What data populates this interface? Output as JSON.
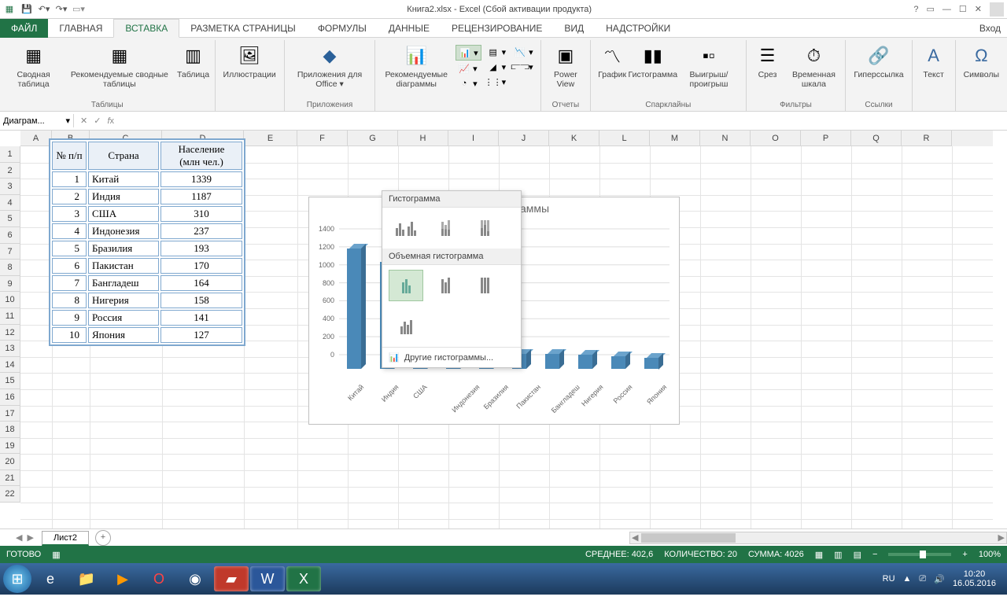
{
  "title": "Книга2.xlsx - Excel (Сбой активации продукта)",
  "signin": "Вход",
  "tabs": {
    "file": "ФАЙЛ",
    "home": "ГЛАВНАЯ",
    "insert": "ВСТАВКА",
    "layout": "РАЗМЕТКА СТРАНИЦЫ",
    "formulas": "ФОРМУЛЫ",
    "data": "ДАННЫЕ",
    "review": "РЕЦЕНЗИРОВАНИЕ",
    "view": "ВИД",
    "addins": "НАДСТРОЙКИ"
  },
  "ribbon": {
    "tables": {
      "pivot": "Сводная\nтаблица",
      "recpivot": "Рекомендуемые\nсводные таблицы",
      "table": "Таблица",
      "group": "Таблицы"
    },
    "illus": {
      "btn": "Иллюстрации"
    },
    "apps": {
      "btn": "Приложения\nдля Office ▾",
      "group": "Приложения"
    },
    "charts": {
      "rec": "Рекомендуемые\ndiаграммы",
      "group": "Диаграммы"
    },
    "reports": {
      "pv": "Power\nView",
      "group": "Отчеты"
    },
    "spark": {
      "line": "График",
      "col": "Гистограмма",
      "wl": "Выигрыш/\nпроигрыш",
      "group": "Спарклайны"
    },
    "filters": {
      "slicer": "Срез",
      "timeline": "Временная\nшкала",
      "group": "Фильтры"
    },
    "links": {
      "hyper": "Гиперссылка",
      "group": "Ссылки"
    },
    "text": {
      "btn": "Текст"
    },
    "symbols": {
      "btn": "Символы"
    }
  },
  "namebox": "Диаграм...",
  "columns": [
    "A",
    "B",
    "C",
    "D",
    "E",
    "F",
    "G",
    "H",
    "I",
    "J",
    "K",
    "L",
    "M",
    "N",
    "O",
    "P",
    "Q",
    "R"
  ],
  "rows": [
    "1",
    "2",
    "3",
    "4",
    "5",
    "6",
    "7",
    "8",
    "9",
    "10",
    "11",
    "12",
    "13",
    "14",
    "15",
    "16",
    "17",
    "18",
    "19",
    "20",
    "21",
    "22"
  ],
  "table": {
    "h1": "№ п/п",
    "h2": "Страна",
    "h3": "Население\n(млн чел.)",
    "rows": [
      {
        "n": "1",
        "c": "Китай",
        "p": "1339"
      },
      {
        "n": "2",
        "c": "Индия",
        "p": "1187"
      },
      {
        "n": "3",
        "c": "США",
        "p": "310"
      },
      {
        "n": "4",
        "c": "Индонезия",
        "p": "237"
      },
      {
        "n": "5",
        "c": "Бразилия",
        "p": "193"
      },
      {
        "n": "6",
        "c": "Пакистан",
        "p": "170"
      },
      {
        "n": "7",
        "c": "Бангладеш",
        "p": "164"
      },
      {
        "n": "8",
        "c": "Нигерия",
        "p": "158"
      },
      {
        "n": "9",
        "c": "Россия",
        "p": "141"
      },
      {
        "n": "10",
        "c": "Япония",
        "p": "127"
      }
    ]
  },
  "dropdown": {
    "s1": "Гистограмма",
    "s2": "Объемная гистограмма",
    "more": "Другие гистограммы..."
  },
  "chart_data": {
    "type": "bar",
    "title": "Название диаграммы",
    "categories": [
      "Китай",
      "Индия",
      "США",
      "Индонезия",
      "Бразилия",
      "Пакистан",
      "Бангладеш",
      "Нигерия",
      "Россия",
      "Япония"
    ],
    "values": [
      1339,
      1187,
      310,
      237,
      193,
      170,
      164,
      158,
      141,
      127
    ],
    "ylim": [
      0,
      1400
    ],
    "yticks": [
      0,
      200,
      400,
      600,
      800,
      1000,
      1200,
      1400
    ],
    "xlabel": "",
    "ylabel": ""
  },
  "sheet": {
    "name": "Лист2"
  },
  "status": {
    "ready": "ГОТОВО",
    "avg": "СРЕДНЕЕ: 402,6",
    "count": "КОЛИЧЕСТВО: 20",
    "sum": "СУММА: 4026",
    "zoom": "100%"
  },
  "tray": {
    "lang": "RU",
    "time": "10:20",
    "date": "16.05.2016"
  }
}
